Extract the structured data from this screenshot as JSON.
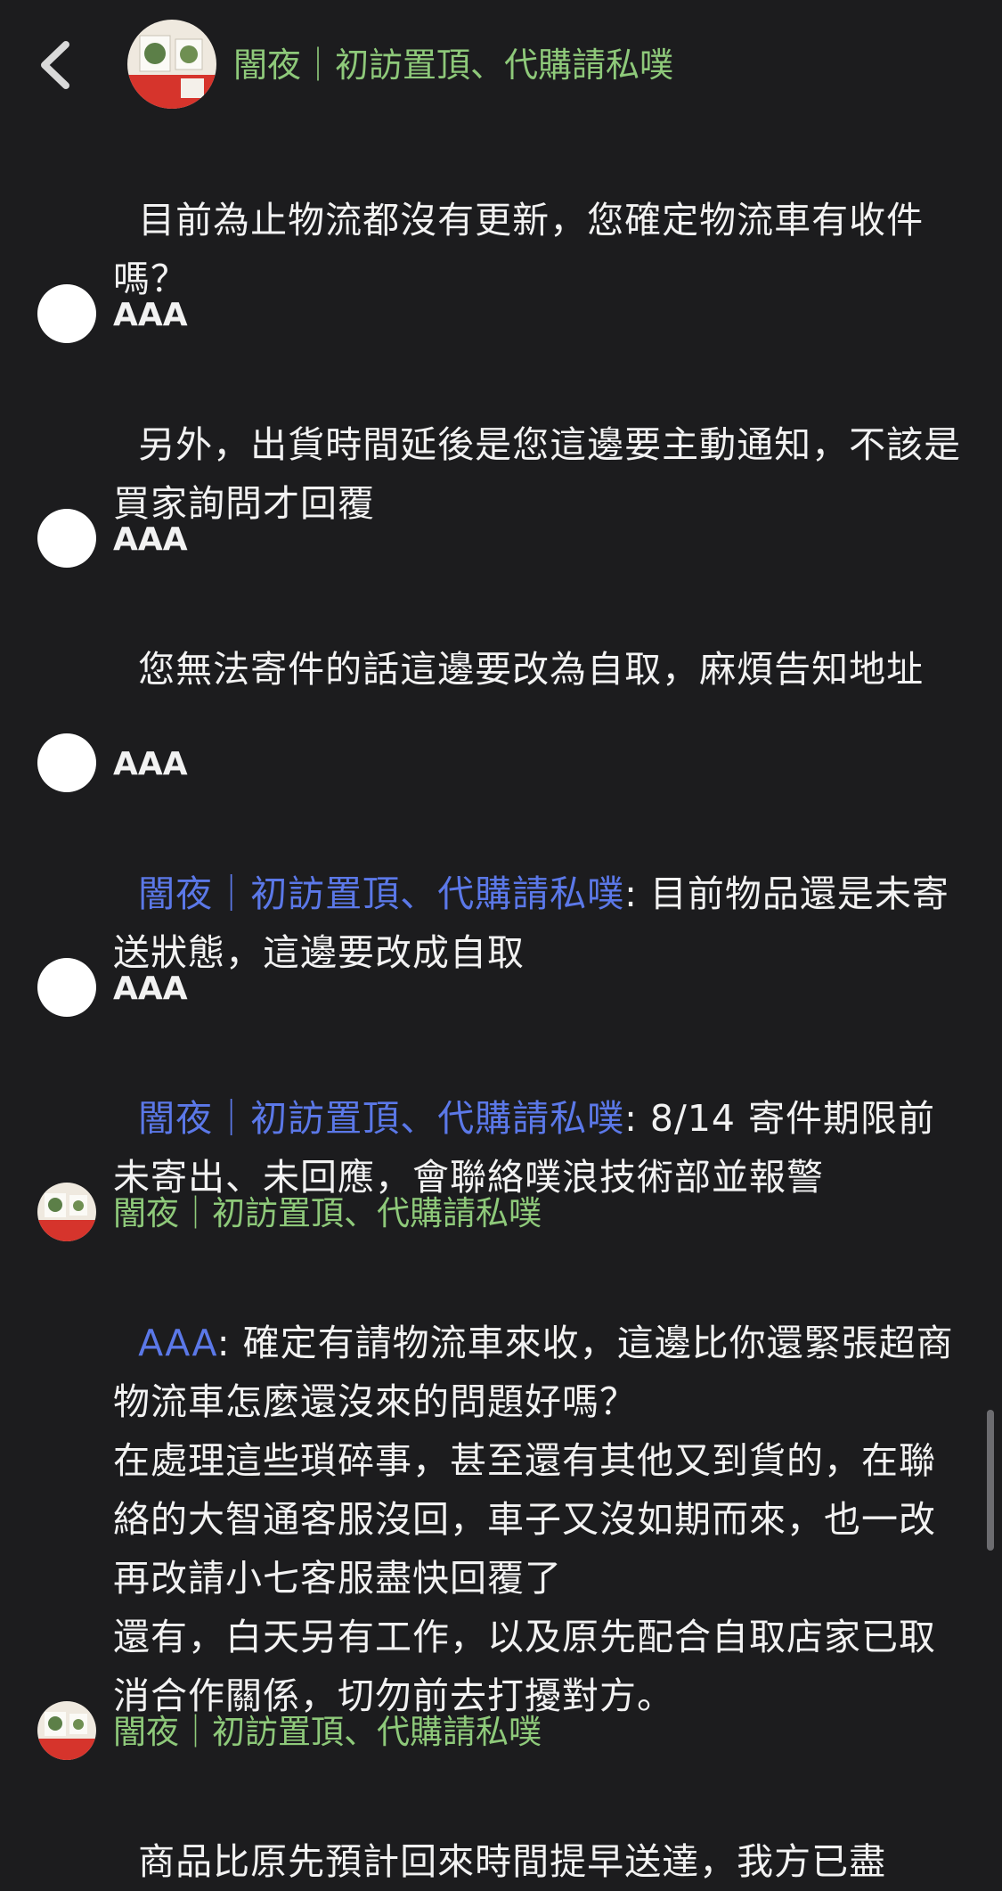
{
  "header": {
    "title": "闇夜｜初訪置頂、代購請私噗",
    "back_icon": "chevron-left-icon"
  },
  "colors": {
    "background": "#1c1c1e",
    "owner_name": "#8ec97a",
    "mention": "#5b78e8",
    "text": "#f2f2f2"
  },
  "messages": [
    {
      "text": "目前為止物流都沒有更新，您確定物流車有收件嗎？"
    },
    {
      "author": "AAA",
      "text": "另外，出貨時間延後是您這邊要主動通知，不該是買家詢問才回覆"
    },
    {
      "author": "AAA",
      "text": "您無法寄件的話這邊要改為自取，麻煩告知地址"
    },
    {
      "author": "AAA",
      "mention": "闇夜｜初訪置頂、代購請私噗",
      "text": ": 目前物品還是未寄送狀態，這邊要改成自取"
    },
    {
      "author": "AAA",
      "mention": "闇夜｜初訪置頂、代購請私噗",
      "text": ": 8/14 寄件期限前未寄出、未回應，會聯絡噗浪技術部並報警"
    },
    {
      "author": "闇夜｜初訪置頂、代購請私噗",
      "mention": "AAA",
      "text": ": 確定有請物流車來收，這邊比你還緊張超商物流車怎麼還沒來的問題好嗎？\n在處理這些瑣碎事，甚至還有其他又到貨的，在聯絡的大智通客服沒回，車子又沒如期而來，也一改再改請小七客服盡快回覆了\n還有，白天另有工作，以及原先配合自取店家已取消合作關係，切勿前去打擾對方。"
    },
    {
      "author": "闇夜｜初訪置頂、代購請私噗",
      "text": "商品比原先預計回來時間提早送達，我方已盡"
    }
  ]
}
